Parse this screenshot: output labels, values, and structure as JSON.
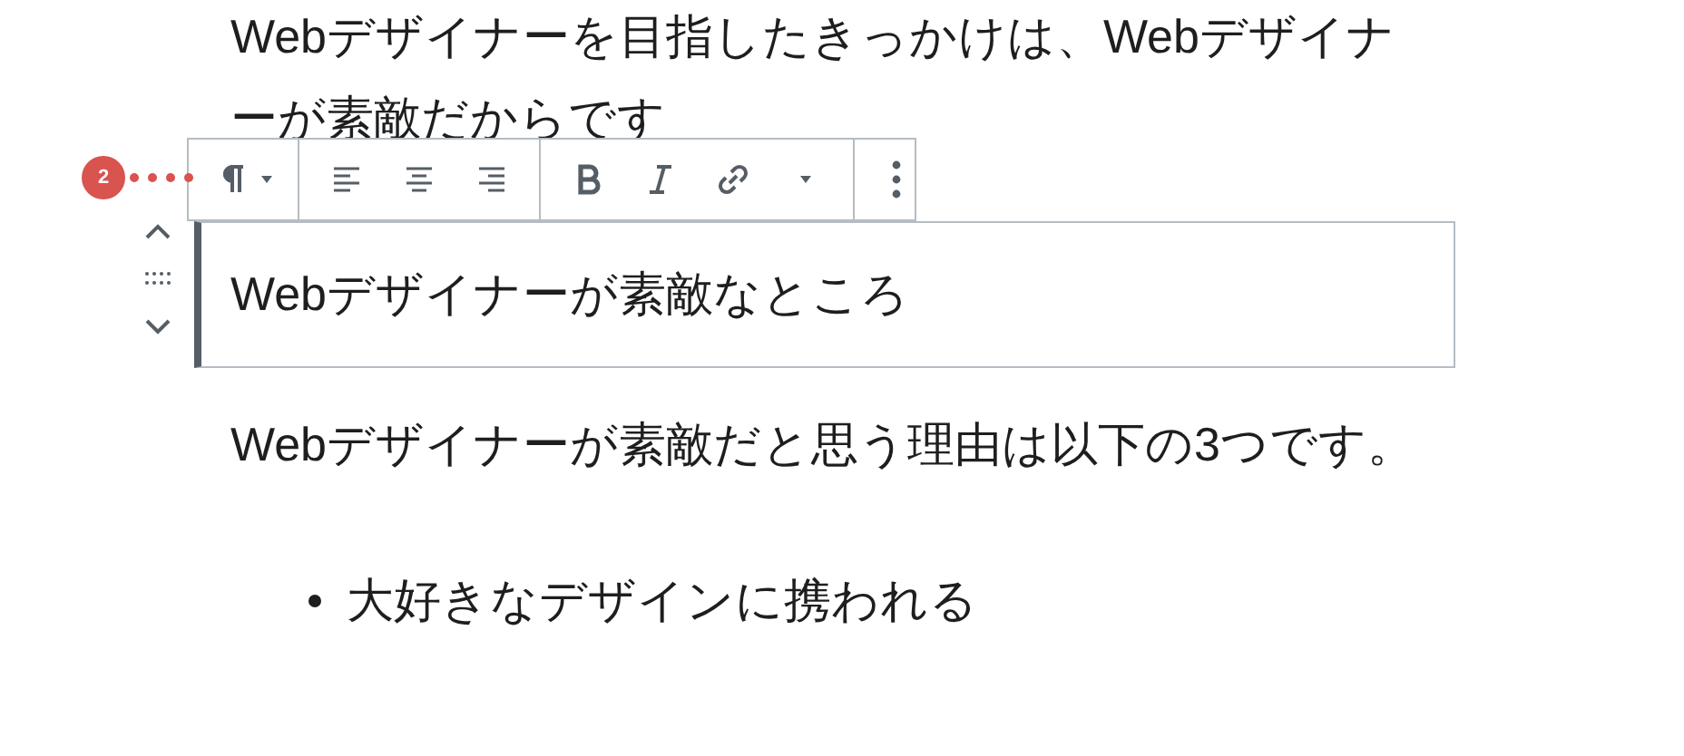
{
  "blocks": [
    {
      "kind": "paragraph",
      "text": "Webデザイナーを目指したきっかけは、Webデザイナーが素敵だからです"
    },
    {
      "kind": "selected",
      "text": "Webデザイナーが素敵なところ"
    },
    {
      "kind": "paragraph",
      "text": "Webデザイナーが素敵だと思う理由は以下の3つです。"
    },
    {
      "kind": "list",
      "items": [
        "大好きなデザインに携われる"
      ]
    }
  ],
  "badge": "2"
}
